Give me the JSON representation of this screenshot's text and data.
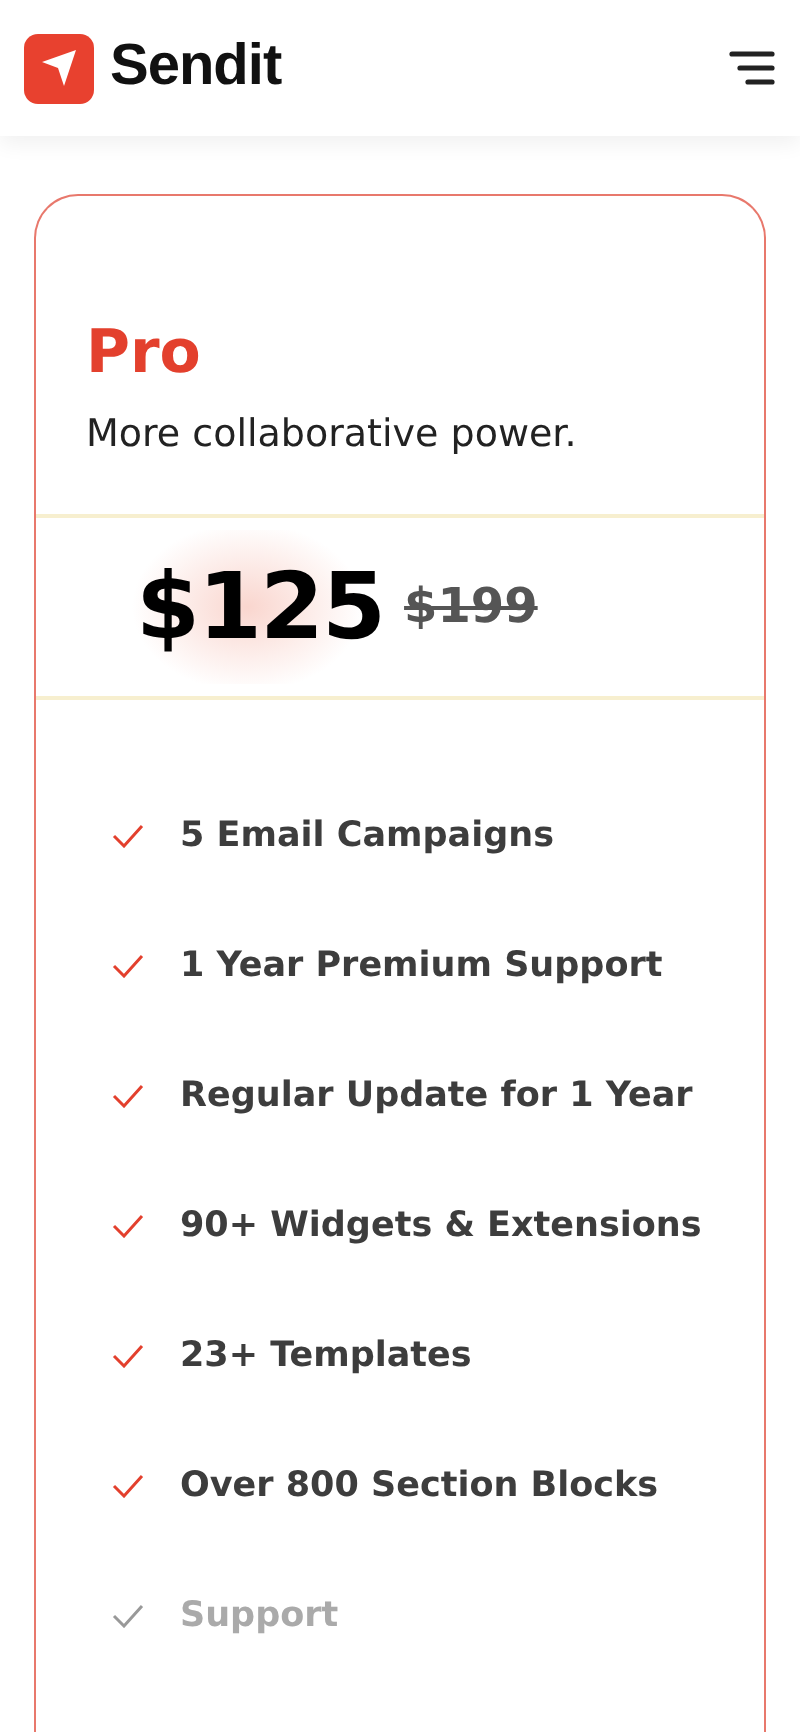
{
  "brand": {
    "name": "Sendit"
  },
  "plan": {
    "name": "Pro",
    "tagline": "More collaborative power.",
    "price": "$125",
    "old_price": "$199"
  },
  "features": [
    {
      "label": "5 Email Campaigns",
      "included": true
    },
    {
      "label": "1 Year Premium Support",
      "included": true
    },
    {
      "label": "Regular Update for 1 Year",
      "included": true
    },
    {
      "label": "90+ Widgets & Extensions",
      "included": true
    },
    {
      "label": "23+ Templates",
      "included": true
    },
    {
      "label": "Over 800 Section Blocks",
      "included": true
    },
    {
      "label": "Support",
      "included": false
    }
  ]
}
